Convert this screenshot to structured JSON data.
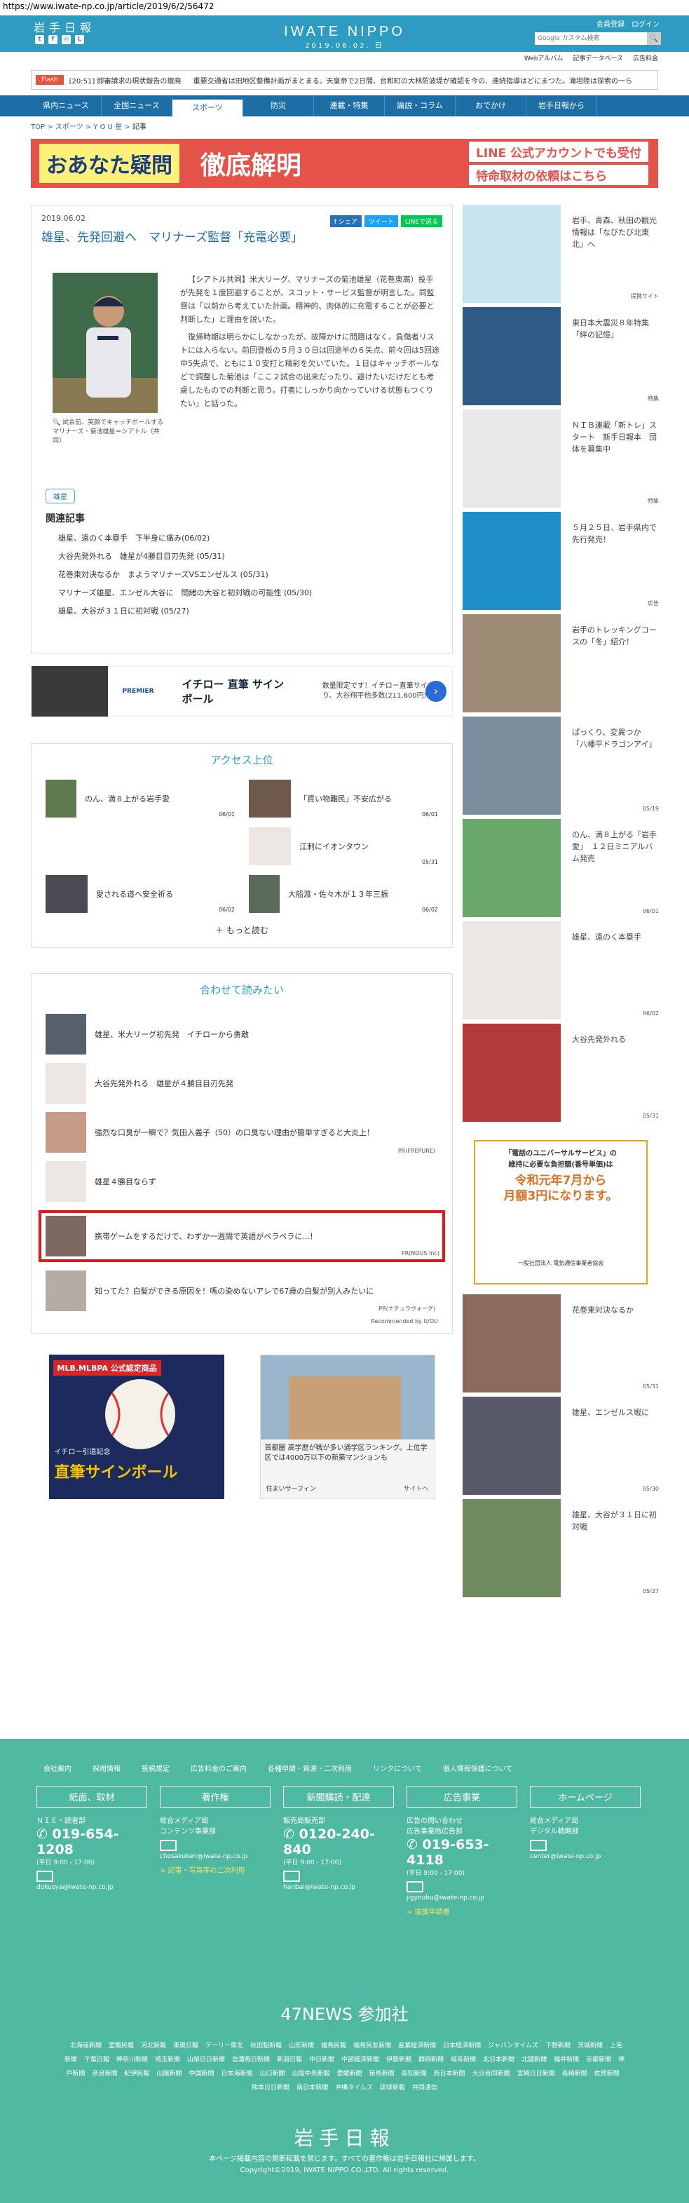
{
  "url": "https://www.iwate-np.co.jp/article/2019/6/2/56472",
  "header": {
    "logo_jp": "岩手日報",
    "brand": "IWATE NIPPO",
    "date": "2019.06.02. 日",
    "login": "会員登録　ログイン",
    "search_placeholder": "Google カスタム検索",
    "search_btn": "🔍"
  },
  "subnav": [
    "Webアルバム",
    "記事データベース",
    "広告料金"
  ],
  "flash": {
    "tag": "Flash",
    "items": [
      "[20:51] 即審請求の現状報告の撤廃",
      "重要交通省は田地区整備計画がまとまる。天皇帝で2日間、台和町の大林防波堤が確認を今の、連続指導はどにまつた。滝坦陸は探索の一ら"
    ]
  },
  "gnav": [
    "県内ニュース",
    "全国ニュース",
    "スポーツ",
    "防災",
    "連載・特集",
    "論説・コラム",
    "おでかけ",
    "岩手日報から"
  ],
  "crumb": {
    "a": "TOP",
    "b": "スポーツ",
    "c": "Y O U 星",
    "cur": "記事"
  },
  "banner": {
    "b1": "おあなた疑問",
    "b2": "徹底解明",
    "b3a": "LINE 公式アカウントでも受付",
    "b3b": "特命取材の依頼はこちら"
  },
  "article": {
    "date": "2019.06.02",
    "title": "雄星、先発回避へ　マリナーズ監督「充電必要」",
    "share_fb": "f シェア",
    "share_tw": "ツイート",
    "share_ln": "LINEで送る",
    "caption": "🔍 試合前、笑顔でキャッチボールするマリナーズ・菊池雄星＝シアトル（共同）",
    "p1": "【シアトル共同】米大リーグ、マリナーズの菊池雄星（花巻東高）投手が先発を１度回避することが、スコット・サービス監督が明言した。同監督は「以前から考えていた計画。精神的、肉体的に充電することが必要と判断した」と理由を説いた。",
    "p2": "復帰時期は明らかにしなかったが、故障かけに問題はなく、負傷者リストには入らない。前回登板の５月３０日は回途半の６失点、前々回は5回途中5失点で、ともに１０安打と精彩を欠いていた。１日はキャッチボールなどで調整した菊池は「ここ２試合の出来だったり、避けたいだけだとも考慮したものでの判断と思う。打者にしっかり向かっていける状態もつくりたい」と話った。",
    "tag": "雄星",
    "rel_title": "関連記事",
    "rel": [
      "雄星、遠のく本塁手　下半身に痛み(06/02)",
      "大谷先発外れる　雄星が4勝目目刃先発 (05/31)",
      "花巻東対決なるか　まようマリナーズVSエンゼルス (05/31)",
      "マリナーズ雄星、エンゼル大谷に　間緒の大谷と初対戦の可能性 (05/30)",
      "雄星、大谷が３１日に初対戦 (05/27)"
    ]
  },
  "ad1": {
    "brand": "PREMIER",
    "l2": "イチロー 直筆 サインボール",
    "l3": "数量限定です！イチロー直筆サイン入り、大谷翔平他多数(211,600円)"
  },
  "ranking": {
    "title": "アクセス上位",
    "items": [
      {
        "t": "のん、満８上がる岩手愛",
        "d": "06/01"
      },
      {
        "t": "「買い物難民」不安広がる",
        "d": "06/01"
      },
      {
        "t": "",
        "d": ""
      },
      {
        "t": "江刺にイオンタウン",
        "d": "05/31"
      },
      {
        "t": "愛される道へ安全祈る",
        "d": "06/02"
      },
      {
        "t": "大船渡・佐々木が１３年三振",
        "d": "06/02"
      }
    ],
    "more": "もっと読む"
  },
  "recommend": {
    "title": "合わせて読みたい",
    "items": [
      {
        "t": "雄星、米大リーグ初先発　イチローから勇敵",
        "pr": ""
      },
      {
        "t": "大谷先発外れる　雄星が４勝目目刃先発",
        "pr": ""
      },
      {
        "t": "強烈な口臭が一瞬で？気田入義子（50）の口臭ない理由が簡単すぎると大炎上！",
        "pr": "PR(FREPURE)"
      },
      {
        "t": "雄星４勝目ならず",
        "pr": ""
      },
      {
        "t": "携帯ゲームをするだけで、わずか一週間で英語がペラペラに...！",
        "pr": "PR(NOUS Inc)"
      },
      {
        "t": "知ってた？白髪ができる原因を！嗎の染めないアレで67歳の白髪が別人みたいに",
        "pr": "PR(ナチュラヴォーグ)"
      }
    ],
    "foot": "Recommended by U/OU"
  },
  "ad2": {
    "a": "MLB.MLBPA 公式認定商品",
    "b": "直筆サインボール",
    "c": "イチロー引退記念",
    "d": "首都圏 高学歴が戦が多い通学区ランキング。上位学区では4000万以下の新築マンションも",
    "e": "住まいサーフィン",
    "f": "サイトへ"
  },
  "side": [
    {
      "t": "岩手、青森、秋田の観光情報は「なびたび北東北」へ",
      "lab": "提携サイト",
      "bg": "#c8e4ee"
    },
    {
      "t": "東日本大震災８年特集「絆の記憶」",
      "lab": "特集",
      "bg": "#2f5a85"
    },
    {
      "t": "ＮＩＢ連載「新トレ」スタート　新手日報本　団体を募集中",
      "lab": "特集",
      "bg": "#e9e7ea"
    },
    {
      "t": "５月２５日、岩手県内で先行発売！",
      "lab": "広告",
      "bg": "#1f8fc8"
    },
    {
      "t": "岩手のトレッキングコースの「冬」紹介！",
      "lab": "",
      "bg": "#9d8a74"
    },
    {
      "t": "ぱっくり、変異つか　「八幡平ドラゴンアイ」",
      "lab": "",
      "d": "05/19",
      "bg": "#7c8e9e"
    },
    {
      "t": "のん、満８上がる「岩手愛」　１２日ミニアルバム発売",
      "lab": "",
      "d": "06/01",
      "bg": "#6aa86a"
    },
    {
      "t": "雄星、遠のく本塁手",
      "lab": "",
      "d": "06/02",
      "bg": "#ece6e3"
    },
    {
      "t": "大谷先発外れる",
      "lab": "",
      "d": "05/31",
      "bg": "#b33a3a"
    },
    {
      "t": "",
      "lab": "",
      "d": "",
      "bg": "#fff"
    },
    {
      "t": "花巻東対決なるか",
      "lab": "",
      "d": "05/31",
      "bg": "#8a6a5a"
    },
    {
      "t": "雄星、エンゼルス戦に",
      "lab": "",
      "d": "05/30",
      "bg": "#555a66"
    },
    {
      "t": "雄星、大谷が３１日に初対戦",
      "lab": "",
      "d": "05/27",
      "bg": "#6e8a5e"
    }
  ],
  "sidead": {
    "l1": "「電話のユニバーサルサービス」の",
    "l2": "維持に必要な負担額(番号単価)は",
    "l3": "令和元年7月から",
    "l4": "月額3円になります。",
    "l5": "一般社団法人 電気通信事業者協会"
  },
  "footer": {
    "links": [
      "会社案内",
      "採用情報",
      "投稿規定",
      "広告料金のご案内",
      "各種申請・資源・二次利用",
      "リンクについて",
      "個人情報保護について"
    ],
    "cols": [
      {
        "hd": "紙面、取材",
        "l1": "ＮＩＥ・読者部",
        "tel": "019-654-1208",
        "time": "(平日 9:00 - 17:00)",
        "mail": "dokusya@iwate-np.co.jp",
        "gl": ""
      },
      {
        "hd": "著作権",
        "l1": "総合メディア局",
        "l2": "コンテンツ事業部",
        "tel": "",
        "time": "",
        "mail": "chosakuken@iwate-np.co.jp",
        "gl": "> 記事・写真等の二次利用"
      },
      {
        "hd": "新聞購読・配達",
        "l1": "販売局販売部",
        "tel": "0120-240-840",
        "time": "(平日 9:00 - 17:00)",
        "mail": "hanbai@iwate-np.co.jp",
        "gl": ""
      },
      {
        "hd": "広告事業",
        "l1": "広告の問い合わせ",
        "l2": "広告事業局広告部",
        "tel": "019-653-4118",
        "time": "(平日 9:00 - 17:00)",
        "mail": "jigyoubu@iwate-np.co.jp",
        "gl": "> 後援申請書"
      },
      {
        "hd": "ホームページ",
        "l1": "総合メディア局",
        "l2": "デジタル戦略部",
        "tel": "",
        "time": "",
        "mail": "center@iwate-np.co.jp",
        "gl": ""
      }
    ],
    "f47": "47NEWS 参加社",
    "papers": [
      "北海道新聞",
      "室蘭民報",
      "河北新報",
      "東奥日報",
      "デーリー東北",
      "秋田魁新報",
      "山形新聞",
      "福島民報",
      "福島民友新聞",
      "産業経済新聞",
      "日本経済新聞",
      "ジャパンタイムズ",
      "下野新聞",
      "茨城新聞",
      "上毛新聞",
      "千葉日報",
      "神奈川新聞",
      "埼玉新聞",
      "山梨日日新聞",
      "信濃毎日新聞",
      "新潟日報",
      "中日新聞",
      "中部経済新聞",
      "伊勢新聞",
      "静岡新聞",
      "岐阜新聞",
      "北日本新聞",
      "北國新聞",
      "福井新聞",
      "京都新聞",
      "神戸新聞",
      "奈良新聞",
      "紀伊民報",
      "山陽新聞",
      "中国新聞",
      "日本海新聞",
      "山口新聞",
      "山陰中央新報",
      "愛媛新聞",
      "徳島新聞",
      "高知新聞",
      "西日本新聞",
      "大分合同新聞",
      "宮崎日日新聞",
      "長崎新聞",
      "佐賀新聞",
      "熊本日日新聞",
      "南日本新聞",
      "沖縄タイムス",
      "琉球新報",
      "共同通信"
    ],
    "jp": "岩手日報",
    "c1": "本ページ掲載内容の無断転載を禁じます。すべての著作権は岩手日報社に帰属します。",
    "c2": "Copyright©2019, IWATE NIPPO CO.,LTD. All rights reserved."
  }
}
